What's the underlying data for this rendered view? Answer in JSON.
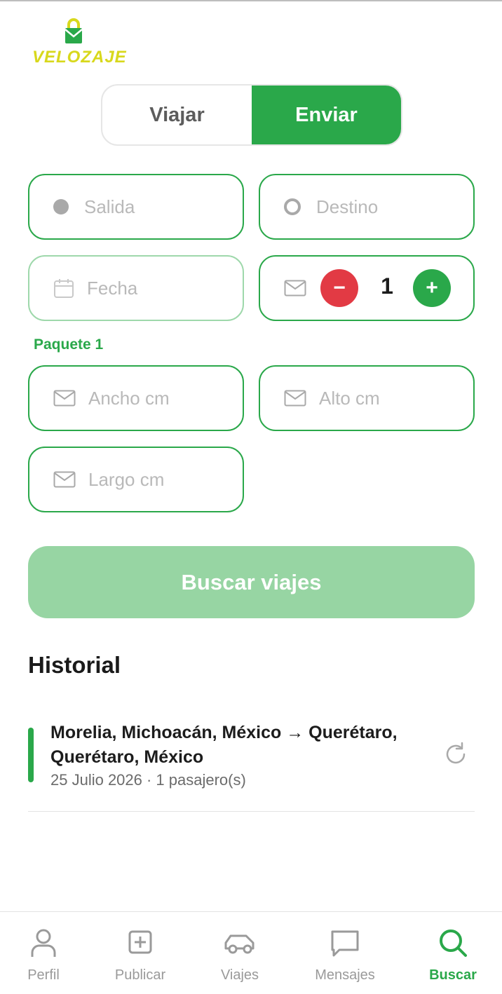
{
  "app": {
    "brand": "VELOZAJE"
  },
  "mode_tabs": [
    {
      "label": "Viajar",
      "active": false
    },
    {
      "label": "Enviar",
      "active": true
    }
  ],
  "form": {
    "origin_placeholder": "Salida",
    "destination_placeholder": "Destino",
    "date_placeholder": "Fecha",
    "package_count": "1",
    "package_label": "Paquete 1",
    "width_placeholder": "Ancho cm",
    "height_placeholder": "Alto cm",
    "length_placeholder": "Largo cm",
    "minus_symbol": "−",
    "plus_symbol": "+"
  },
  "search_button": "Buscar viajes",
  "history": {
    "title": "Historial",
    "items": [
      {
        "route": "Morelia, Michoacán, México → Querétaro, Querétaro, México",
        "meta": "25 Julio 2026 · 1 pasajero(s)"
      }
    ]
  },
  "nav": {
    "items": [
      {
        "label": "Perfil",
        "icon": "user-icon",
        "active": false
      },
      {
        "label": "Publicar",
        "icon": "plus-square-icon",
        "active": false
      },
      {
        "label": "Viajes",
        "icon": "car-icon",
        "active": false
      },
      {
        "label": "Mensajes",
        "icon": "message-icon",
        "active": false
      },
      {
        "label": "Buscar",
        "icon": "search-icon",
        "active": true
      }
    ]
  },
  "colors": {
    "accent": "#2aa84a",
    "danger": "#e23a44",
    "brand_yellow": "#d8d81c"
  }
}
